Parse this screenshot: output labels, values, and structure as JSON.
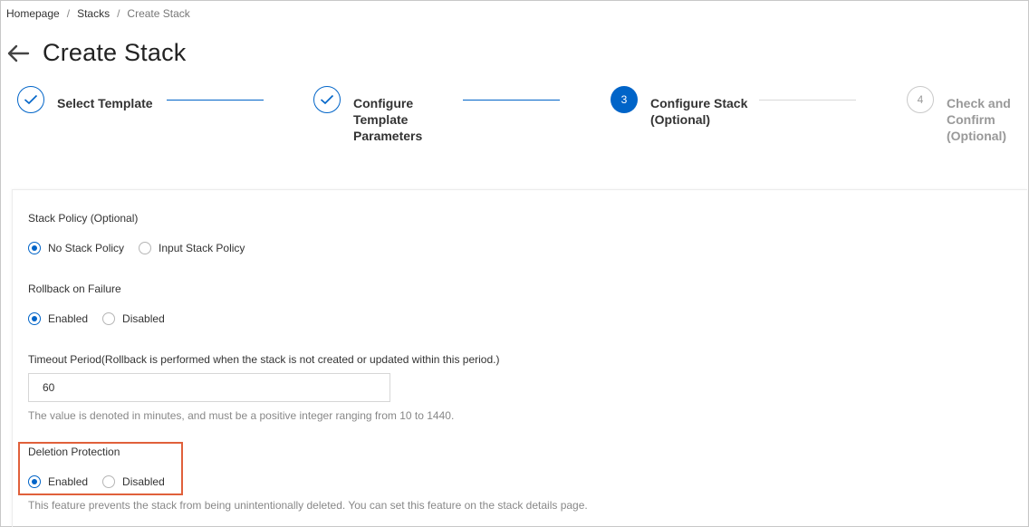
{
  "breadcrumb": {
    "home": "Homepage",
    "stacks": "Stacks",
    "current": "Create Stack",
    "separator": "/"
  },
  "page": {
    "title": "Create Stack"
  },
  "icons": {
    "back": "arrow-left-icon",
    "check": "check-icon"
  },
  "colors": {
    "accent": "#0064c8",
    "highlight": "#e0603b"
  },
  "steps": [
    {
      "label": "Select Template",
      "state": "done"
    },
    {
      "label": "Configure Template Parameters",
      "state": "done"
    },
    {
      "number": "3",
      "label": "Configure Stack (Optional)",
      "state": "active"
    },
    {
      "number": "4",
      "label": "Check and Confirm (Optional)",
      "state": "pending"
    }
  ],
  "form": {
    "stack_policy": {
      "label": "Stack Policy (Optional)",
      "options": [
        "No Stack Policy",
        "Input Stack Policy"
      ],
      "selected": "No Stack Policy"
    },
    "rollback": {
      "label": "Rollback on Failure",
      "options": [
        "Enabled",
        "Disabled"
      ],
      "selected": "Enabled"
    },
    "timeout": {
      "label": "Timeout Period(Rollback is performed when the stack is not created or updated within this period.)",
      "value": "60",
      "hint": "The value is denoted in minutes, and must be a positive integer ranging from 10 to 1440."
    },
    "deletion_protection": {
      "label": "Deletion Protection",
      "options": [
        "Enabled",
        "Disabled"
      ],
      "selected": "Enabled",
      "hint": "This feature prevents the stack from being unintentionally deleted. You can set this feature on the stack details page."
    }
  }
}
